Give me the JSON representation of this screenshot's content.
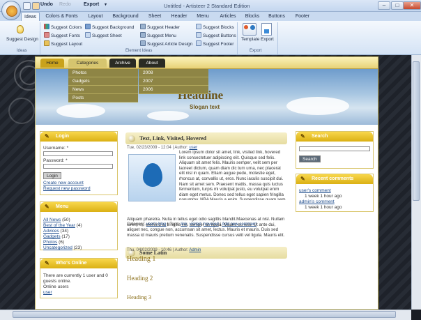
{
  "app": {
    "window_title": "Untitled - Artisteer 2 Standard Edition",
    "quick_access": {
      "undo": "Undo",
      "redo": "Redo",
      "export": "Export"
    },
    "tabs": [
      "Ideas",
      "Colors & Fonts",
      "Layout",
      "Background",
      "Sheet",
      "Header",
      "Menu",
      "Articles",
      "Blocks",
      "Buttons",
      "Footer"
    ],
    "ribbon": {
      "ideas_group": {
        "button": "Suggest Design",
        "label": "Ideas"
      },
      "element_ideas": {
        "col1": [
          "Suggest Colors",
          "Suggest Fonts",
          "Suggest Layout"
        ],
        "col2": [
          "Suggest Background",
          "Suggest Sheet"
        ],
        "col3": [
          "Suggest Header",
          "Suggest Menu",
          "Suggest Article Design"
        ],
        "col4": [
          "Suggest Blocks",
          "Suggest Buttons",
          "Suggest Footer"
        ],
        "label": "Element Ideas"
      },
      "export_group": {
        "template": "Template",
        "export": "Export",
        "label": "Export"
      }
    }
  },
  "site": {
    "nav": [
      "Home",
      "Categories",
      "Archive",
      "About"
    ],
    "categories_menu": [
      "Photos",
      "Gadgets",
      "News",
      "Posts"
    ],
    "archive_menu": [
      "2008",
      "2007",
      "2006"
    ],
    "headline": "Headline",
    "slogan": "Slogan text",
    "login": {
      "title": "Login",
      "username_label": "Username: *",
      "password_label": "Password: *",
      "button": "Login",
      "create_account": "Create new account",
      "request_password": "Request new password"
    },
    "menu": {
      "title": "Menu",
      "items": [
        {
          "label": "All News",
          "count": "(50)"
        },
        {
          "label": "Best of the Year",
          "count": "(4)"
        },
        {
          "label": "Advices",
          "count": "(34)"
        },
        {
          "label": "Gadgets",
          "count": "(17)"
        },
        {
          "label": "Photos",
          "count": "(6)"
        },
        {
          "label": "Uncategorized",
          "count": "(23)"
        }
      ]
    },
    "whos_online": {
      "title": "Who's Online",
      "line1": "There are currently 1 user and 0",
      "line2": "guests online.",
      "line3": "Online users",
      "user": "user"
    },
    "post1": {
      "title": "Text, Link, Visited, Hovered",
      "meta_date": "Tue, 02/23/2009 - 12:04",
      "meta_author_label": "Author:",
      "meta_author": "user",
      "body": "Lorem ipsum dolor sit amet, link, visited link, hovered link consectetuer adipiscing elit. Quisque sed felis. Aliquam sit amet felis. Mauris semper, velit sem per laoreet dictum, quam diam dic tum urna, nec placerat elit nisl in quam. Etiam augue pede, molestie eget, rhoncus at, convallis ut, eros. Nunc iaculis suscipit dui. Nam sit amet sem. Praesent mattis, massa quis luctus fermentum, turpis mi volutpat justo, eu volutpat enim diam eget metus. Donec sed tellus eget sapien fringilla nonummy. NBA Mauris a enim. Suspendisse quam sem, consequat at, commodo vitae, feugiat in, nunc. Morbi imperdiet augue quis tellus. AVE",
      "body2": "Aliquam pharetra. Nulla in tellus eget odio sagittis blandit.Maecenas at nisl. Nullam lorem mi, eleifend a, fringilla vel, semper at, ligula. Mauris eu wisi. Ut ante dui, aliquet nec, congue non, accumsan sit amet, lectus. Mauris et mauris. Duis sed massa id mauris pretium venenatis. Suspendisse cursus velit vel ligula. Mauris elit.",
      "category_label": "Category:",
      "category": "user's blog",
      "tags_label": "Tags:",
      "tags": [
        "link",
        "visited",
        "hovered"
      ],
      "comment_link": "Add new comment"
    },
    "post2": {
      "title": "Some Latin",
      "meta_date": "Thu, 04/02/2009 - 10:46",
      "meta_author_label": "Author:",
      "meta_author": "Admin",
      "h1": "Heading 1",
      "h2": "Heading 2",
      "h3": "Heading 3"
    },
    "search": {
      "title": "Search",
      "button": "Search"
    },
    "recent": {
      "title": "Recent comments",
      "items": [
        {
          "link": "user's comment",
          "time": "1 week 1 hour ago"
        },
        {
          "link": "admin's comment",
          "time": "1 week 1 hour ago"
        }
      ]
    }
  }
}
